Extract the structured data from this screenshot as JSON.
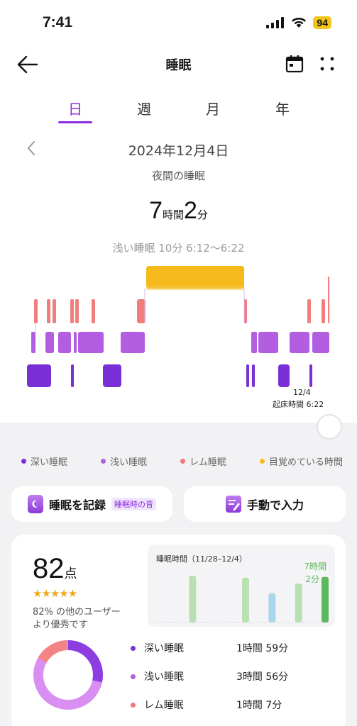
{
  "status": {
    "time": "7:41",
    "battery": "94"
  },
  "header": {
    "title": "睡眠"
  },
  "tabs": [
    "日",
    "週",
    "月",
    "年"
  ],
  "date": "2024年12月4日",
  "sleep_type": "夜間の睡眠",
  "duration": {
    "hours": "7",
    "hours_unit": "時間",
    "minutes": "2",
    "minutes_unit": "分"
  },
  "segment_info": "浅い睡眠 10分 6:12～6:22",
  "wake": {
    "date": "12/4",
    "label": "起床時間 6:22"
  },
  "legend": [
    {
      "label": "深い睡眠",
      "color": "#7a2fd6"
    },
    {
      "label": "浅い睡眠",
      "color": "#b45ee0"
    },
    {
      "label": "レム睡眠",
      "color": "#f07a7a"
    },
    {
      "label": "目覚めている時間",
      "color": "#f5b91c"
    }
  ],
  "buttons": {
    "record": "睡眠を記録",
    "record_badge": "睡眠時の音",
    "manual": "手動で入力"
  },
  "score": {
    "value": "82",
    "unit": "点",
    "stars": "★★★★★",
    "note_line1": "82% の他のユーザー",
    "note_line2": "より優秀です"
  },
  "weekly": {
    "title": "睡眠時間（11/28–12/4）",
    "last_label_line1": "7時間",
    "last_label_line2": "2分"
  },
  "stages": [
    {
      "name": "深い睡眠",
      "duration": "1時間 59分",
      "color": "#7a2fd6"
    },
    {
      "name": "浅い睡眠",
      "duration": "3時間 56分",
      "color": "#b45ee0"
    },
    {
      "name": "レム睡眠",
      "duration": "1時間 7分",
      "color": "#f07a7a"
    }
  ],
  "chart_data": {
    "type": "bar",
    "title": "睡眠時間（11/28–12/4）",
    "categories": [
      "",
      "",
      "",
      "",
      "",
      "",
      ""
    ],
    "values": [
      null,
      7.2,
      null,
      6.9,
      4.5,
      6.0,
      7.03
    ],
    "ylim": [
      0,
      12
    ]
  }
}
